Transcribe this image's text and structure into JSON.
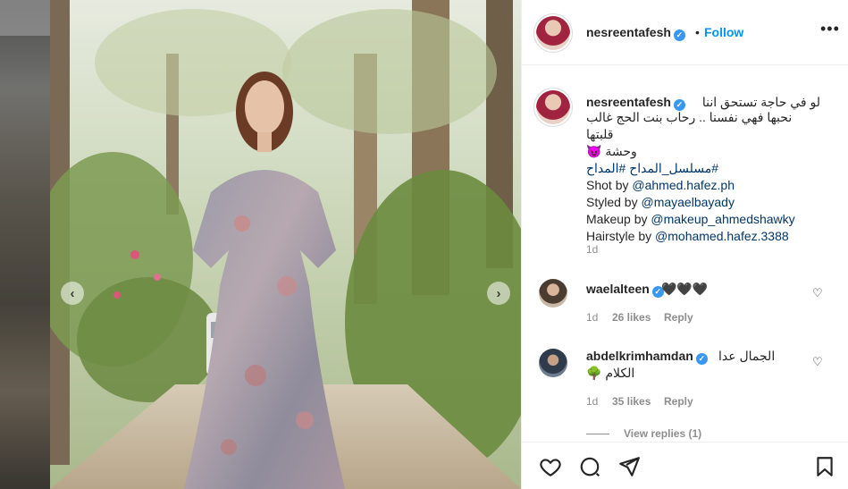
{
  "post": {
    "username": "nesreentafesh",
    "follow_separator": "•",
    "follow_label": "Follow",
    "more_label": "•••",
    "caption": {
      "arabic_line1": "لو في حاجة تستحق اننا",
      "arabic_line2": "نحبها فهي نفسنا .. رحاب بنت الحج غالب قلبتها",
      "arabic_line3": "وحشة 😈",
      "hashtags": "#مسلسل_المداح #المداح",
      "shot_by_prefix": "Shot by ",
      "shot_by_handle": "@ahmed.hafez.ph",
      "styled_by_prefix": "Styled by ",
      "styled_by_handle": "@mayaelbayady",
      "makeup_by_prefix": "Makeup by ",
      "makeup_by_handle": "@makeup_ahmedshawky",
      "hairstyle_by_prefix": "Hairstyle by ",
      "hairstyle_by_handle": "@mohamed.hafez.3388"
    },
    "time": "1d"
  },
  "comments": [
    {
      "username": "waelalteen",
      "text": "🖤🖤🖤",
      "time": "1d",
      "likes": "26 likes",
      "reply": "Reply"
    },
    {
      "username": "abdelkrimhamdan",
      "text_line1": "الجمال عدا",
      "text_line2": "الكلام 🌳",
      "time": "1d",
      "likes": "35 likes",
      "reply": "Reply"
    }
  ],
  "view_replies": "View replies (1)",
  "icons": {
    "like": "heart-icon",
    "comment": "comment-icon",
    "share": "share-icon",
    "save": "bookmark-icon",
    "verified": "verified-badge-icon",
    "prev": "chevron-left-icon",
    "next": "chevron-right-icon"
  },
  "colors": {
    "link": "#00376b",
    "follow": "#0095f6",
    "verified": "#3897f0",
    "muted": "#8e8e8e"
  }
}
